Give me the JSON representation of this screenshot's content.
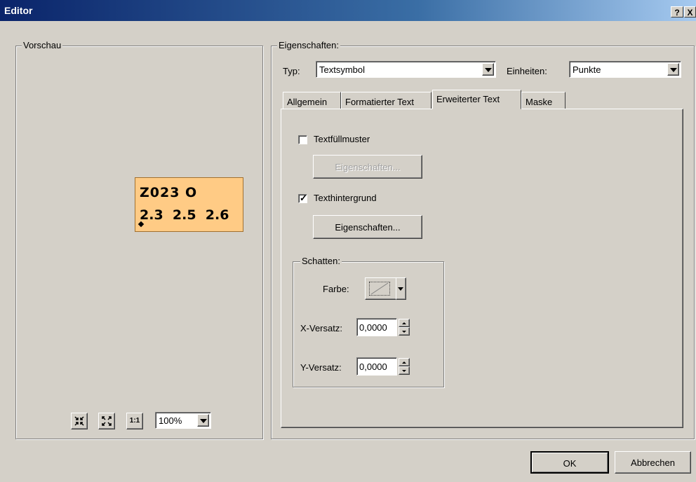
{
  "window": {
    "title": "Editor",
    "help_btn": "?",
    "close_btn": "X"
  },
  "preview": {
    "label": "Vorschau",
    "symbol_line1": "Z023 O",
    "symbol_line2": "2.3  2.5  2.6",
    "symbol_bg": "#ffcb85",
    "zoom_value": "100%",
    "tools": [
      "zoom-in-icon",
      "zoom-out-icon",
      "actual-size-icon"
    ],
    "actual_size_glyph": "1:1"
  },
  "properties": {
    "label": "Eigenschaften:",
    "typ_label": "Typ:",
    "typ_value": "Textsymbol",
    "einheiten_label": "Einheiten:",
    "einheiten_value": "Punkte",
    "tabs": [
      {
        "label": "Allgemein",
        "active": false
      },
      {
        "label": "Formatierter Text",
        "active": false
      },
      {
        "label": "Erweiterter Text",
        "active": true
      },
      {
        "label": "Maske",
        "active": false
      }
    ],
    "fill_checkbox": {
      "label": "Textfüllmuster",
      "checked": false
    },
    "fill_props_button": {
      "label": "Eigenschaften...",
      "enabled": false
    },
    "bg_checkbox": {
      "label": "Texthintergrund",
      "checked": true
    },
    "bg_props_button": {
      "label": "Eigenschaften...",
      "enabled": true
    },
    "shadow": {
      "label": "Schatten:",
      "color_label": "Farbe:",
      "x_label": "X-Versatz:",
      "x_value": "0,0000",
      "y_label": "Y-Versatz:",
      "y_value": "0,0000"
    }
  },
  "footer": {
    "ok": "OK",
    "cancel": "Abbrechen"
  }
}
